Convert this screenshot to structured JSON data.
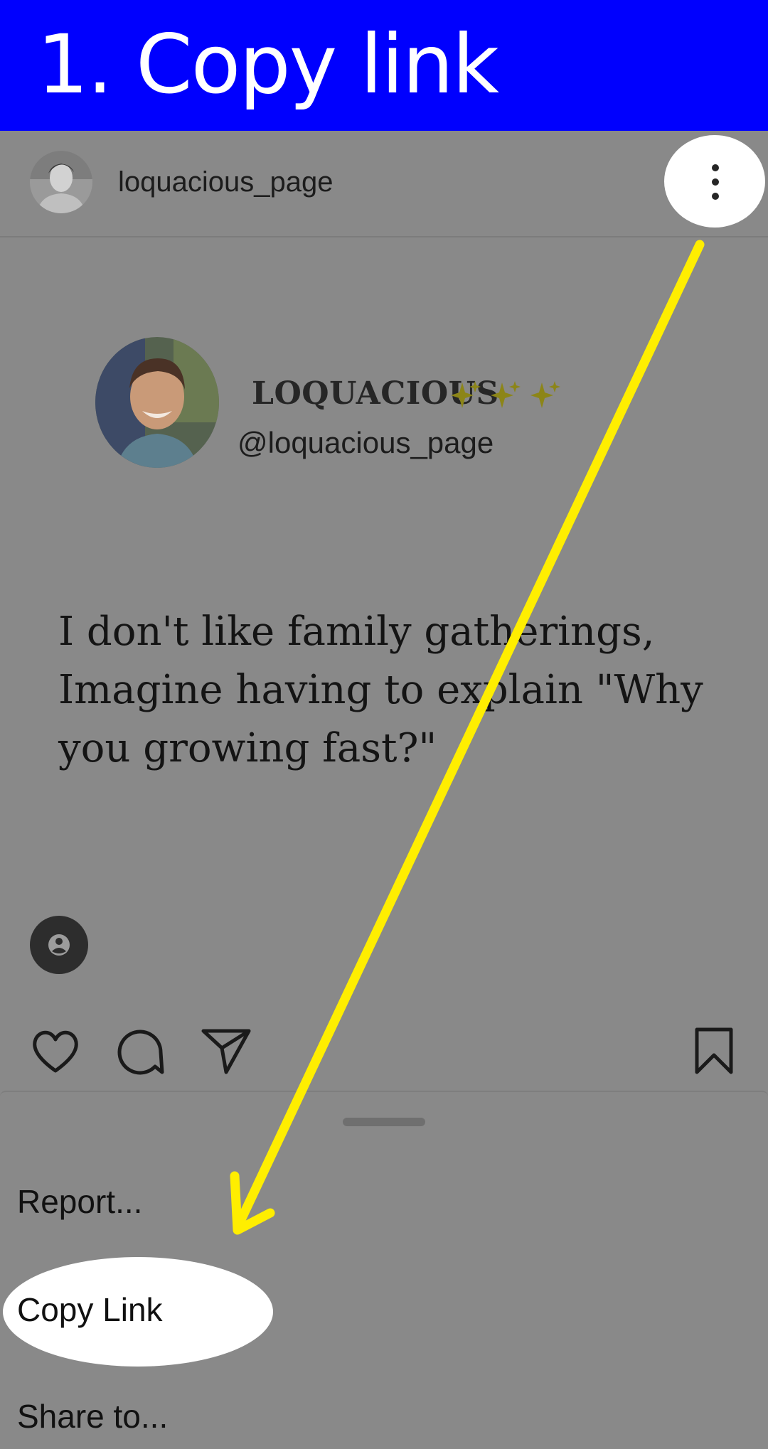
{
  "banner": {
    "title": "1. Copy link",
    "color": "#0000fe"
  },
  "post": {
    "username": "loquacious_page",
    "menu_icon": "more-vertical-icon",
    "display_name": "LOQUACIOUS",
    "display_name_emoji": "sparkles-icon",
    "handle": "@loquacious_page",
    "quote_lines": [
      "I don't like family gatherings,",
      "Imagine having to explain \"Why",
      "you growing fast?\""
    ]
  },
  "actions": {
    "like_icon": "heart-icon",
    "comment_icon": "comment-icon",
    "share_icon": "send-icon",
    "save_icon": "bookmark-icon",
    "tag_icon": "user-tag-icon"
  },
  "sheet": {
    "items": [
      {
        "label": "Report..."
      },
      {
        "label": "Copy Link"
      },
      {
        "label": "Share to..."
      }
    ]
  },
  "annotation": {
    "arrow_color": "#ffee00",
    "highlight_color": "#ffffff"
  }
}
